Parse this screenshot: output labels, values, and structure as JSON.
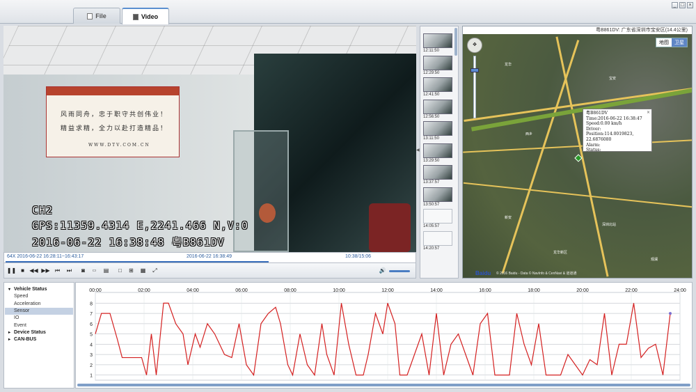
{
  "tabs": [
    {
      "label": "File",
      "icon": "file-icon"
    },
    {
      "label": "Video",
      "icon": "video-icon"
    }
  ],
  "window_controls": [
    "minimize-icon",
    "restore-icon",
    "close-icon"
  ],
  "video": {
    "osd_channel": "CH2",
    "osd_gps": "GPS:11359.4314 E,2241.466 N,V:0",
    "osd_datetime": "2016-06-22 16:38:48 粤B861DV",
    "sign_line1": "风雨同舟，忠于职守共创伟业！",
    "sign_line2": "精益求精，全力以赴打造精品！",
    "sign_url": "WWW.DTV.COM.CN"
  },
  "video_timeline": {
    "range": "64X 2016-06-22 16:28:11~16:43:17",
    "current": "2016-06-22 16:38:49",
    "position": "10:38/15:06",
    "progress": 0.64
  },
  "controls": [
    "pause-icon",
    "stop-icon",
    "rewind-icon",
    "fast-forward-icon",
    "prev-frame-icon",
    "next-frame-icon",
    "snapshot-icon",
    "full-icon",
    "print-icon",
    "single-view-icon",
    "quad-view-icon",
    "multi-view-icon",
    "fullscreen-icon",
    "volume-icon"
  ],
  "thumbnails": [
    {
      "time": "12:11:50",
      "filled": true
    },
    {
      "time": "12:29:50",
      "filled": true
    },
    {
      "time": "12:41:50",
      "filled": true
    },
    {
      "time": "12:56:50",
      "filled": true
    },
    {
      "time": "13:11:50",
      "filled": true
    },
    {
      "time": "13:29:50",
      "filled": true
    },
    {
      "time": "13:37:57",
      "filled": true
    },
    {
      "time": "13:50:57",
      "filled": true
    },
    {
      "time": "14:05:57",
      "filled": false
    },
    {
      "time": "14:20:57",
      "filled": false
    }
  ],
  "map": {
    "header": "粤B861DV: 广东省深圳市宝安区(14.4公里)",
    "type_options": [
      "地图",
      "卫星"
    ],
    "selected_type": "卫星",
    "popup": {
      "title": "粤B861DV",
      "time": "Time:2016-06-22 16:38:47",
      "speed": "Speed:0.00 km/h",
      "driver": "Driver:",
      "position": "Position:114.0019823, 22.6876080",
      "alarm": "Alarm:",
      "status": "Status:"
    },
    "logo": "Baidu",
    "copyright": "© 2016 Baidu - Data © NavInfo & CenNavi & 道道通",
    "labels": [
      "龙华",
      "宝安",
      "西乡",
      "民治",
      "新安",
      "深圳北站",
      "龙华新区",
      "观澜"
    ]
  },
  "tree": [
    {
      "label": "Vehicle Status",
      "type": "group",
      "expanded": true
    },
    {
      "label": "Speed",
      "type": "child"
    },
    {
      "label": "Acceleration",
      "type": "child"
    },
    {
      "label": "Sensor",
      "type": "child",
      "selected": true
    },
    {
      "label": "IO",
      "type": "child"
    },
    {
      "label": "Event",
      "type": "child"
    },
    {
      "label": "Device Status",
      "type": "group",
      "expanded": false
    },
    {
      "label": "CAN-BUS",
      "type": "group",
      "expanded": false
    }
  ],
  "chart_data": {
    "type": "line",
    "x_ticks": [
      "00:00",
      "02:00",
      "04:00",
      "06:00",
      "08:00",
      "10:00",
      "12:00",
      "14:00",
      "16:00",
      "18:00",
      "20:00",
      "22:00",
      "24:00"
    ],
    "y_ticks": [
      1,
      2,
      3,
      4,
      5,
      6,
      7,
      8
    ],
    "ylim": [
      0.5,
      8.5
    ],
    "xlim": [
      0,
      24
    ],
    "grid": true,
    "series": [
      {
        "color": "#d42020",
        "x": [
          0,
          0.25,
          0.6,
          0.9,
          1.1,
          1.3,
          1.6,
          1.9,
          2.1,
          2.3,
          2.5,
          2.8,
          3.0,
          3.3,
          3.6,
          3.8,
          4.1,
          4.3,
          4.6,
          4.9,
          5.1,
          5.3,
          5.6,
          5.9,
          6.2,
          6.5,
          6.8,
          7.1,
          7.4,
          7.6,
          7.9,
          8.1,
          8.4,
          8.7,
          9.0,
          9.3,
          9.5,
          9.8,
          10.1,
          10.4,
          10.7,
          11.0,
          11.2,
          11.5,
          11.8,
          12.0,
          12.3,
          12.5,
          12.8,
          13.1,
          13.4,
          13.7,
          14.0,
          14.3,
          14.6,
          14.9,
          15.2,
          15.5,
          15.8,
          16.1,
          16.4,
          16.7,
          17.0,
          17.3,
          17.6,
          17.9,
          18.2,
          18.5,
          18.8,
          19.1,
          19.4,
          19.7,
          20.0,
          20.3,
          20.6,
          20.9,
          21.2,
          21.5,
          21.8,
          22.1,
          22.4,
          22.7,
          23.0,
          23.3,
          23.6
        ],
        "values": [
          5,
          7,
          7,
          4.5,
          2.7,
          2.7,
          2.7,
          2.7,
          1,
          5,
          1,
          8,
          8,
          6,
          5,
          2,
          5,
          3.7,
          6,
          5,
          4,
          3,
          2.7,
          6,
          2,
          1,
          6,
          7,
          7.6,
          6,
          2,
          1,
          5,
          2,
          1,
          6,
          3,
          1,
          8,
          4,
          1,
          1,
          3,
          7,
          5,
          8,
          6,
          1,
          1,
          3,
          5,
          1,
          7,
          1,
          4,
          5,
          3,
          1,
          6,
          7,
          1,
          1,
          1,
          7,
          4,
          2,
          6,
          1,
          1,
          1,
          3,
          2,
          1,
          2.5,
          2,
          7,
          1,
          4,
          4,
          8,
          2.7,
          3.6,
          4,
          1,
          7
        ]
      }
    ]
  }
}
